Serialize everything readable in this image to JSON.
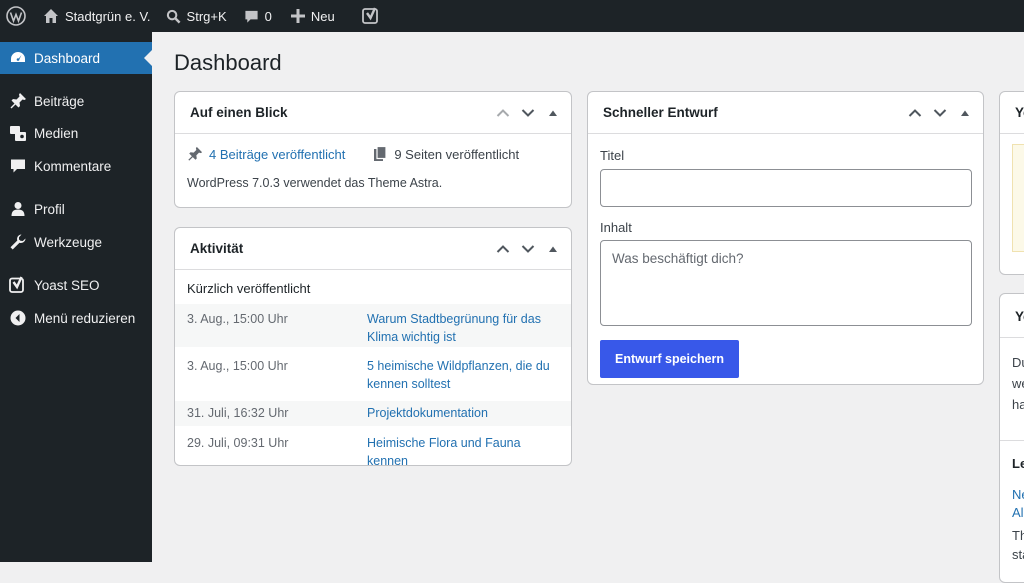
{
  "adminbar": {
    "site_name": "Stadtgrün e. V.",
    "search_shortcut": "Strg+K",
    "comments_count": "0",
    "new_label": "Neu"
  },
  "sidebar": {
    "items": [
      {
        "label": "Dashboard",
        "icon": "dashboard-icon",
        "current": true
      },
      {
        "label": "Beiträge",
        "icon": "pin-icon"
      },
      {
        "label": "Medien",
        "icon": "media-icon"
      },
      {
        "label": "Kommentare",
        "icon": "comment-icon"
      },
      {
        "label": "Profil",
        "icon": "user-icon"
      },
      {
        "label": "Werkzeuge",
        "icon": "wrench-icon"
      },
      {
        "label": "Yoast SEO",
        "icon": "yoast-icon"
      },
      {
        "label": "Menü reduzieren",
        "icon": "collapse-icon"
      }
    ]
  },
  "page": {
    "title": "Dashboard"
  },
  "glance": {
    "title": "Auf einen Blick",
    "posts": "4 Beiträge veröffentlicht",
    "pages": "9 Seiten veröffentlicht",
    "footer": "WordPress 7.0.3 verwendet das Theme Astra."
  },
  "activity": {
    "title": "Aktivität",
    "subtitle": "Kürzlich veröffentlicht",
    "rows": [
      {
        "date": "3. Aug., 15:00 Uhr",
        "title": "Warum Stadtbegrünung für das Klima wichtig ist"
      },
      {
        "date": "3. Aug., 15:00 Uhr",
        "title": "5 heimische Wildpflanzen, die du kennen solltest"
      },
      {
        "date": "31. Juli, 16:32 Uhr",
        "title": "Projektdokumentation"
      },
      {
        "date": "29. Juli, 09:31 Uhr",
        "title": "Heimische Flora und Fauna kennen"
      }
    ]
  },
  "quickdraft": {
    "title": "Schneller Entwurf",
    "title_label": "Titel",
    "title_value": "",
    "content_label": "Inhalt",
    "content_placeholder": "Was beschäftigt dich?",
    "save_label": "Entwurf speichern"
  },
  "clipped": {
    "box1_title": "Yo",
    "box2_title": "Yo",
    "line1": "Du",
    "line2": "we",
    "line3": "ha",
    "heading": "Le",
    "link1": "Ne",
    "link2": "Al",
    "line4": "Th",
    "line5": "sta"
  },
  "colors": {
    "adminbar_bg": "#1d2327",
    "accent": "#2271b1",
    "primary_button": "#3858e9",
    "notice_bg": "#fcf9e8"
  }
}
